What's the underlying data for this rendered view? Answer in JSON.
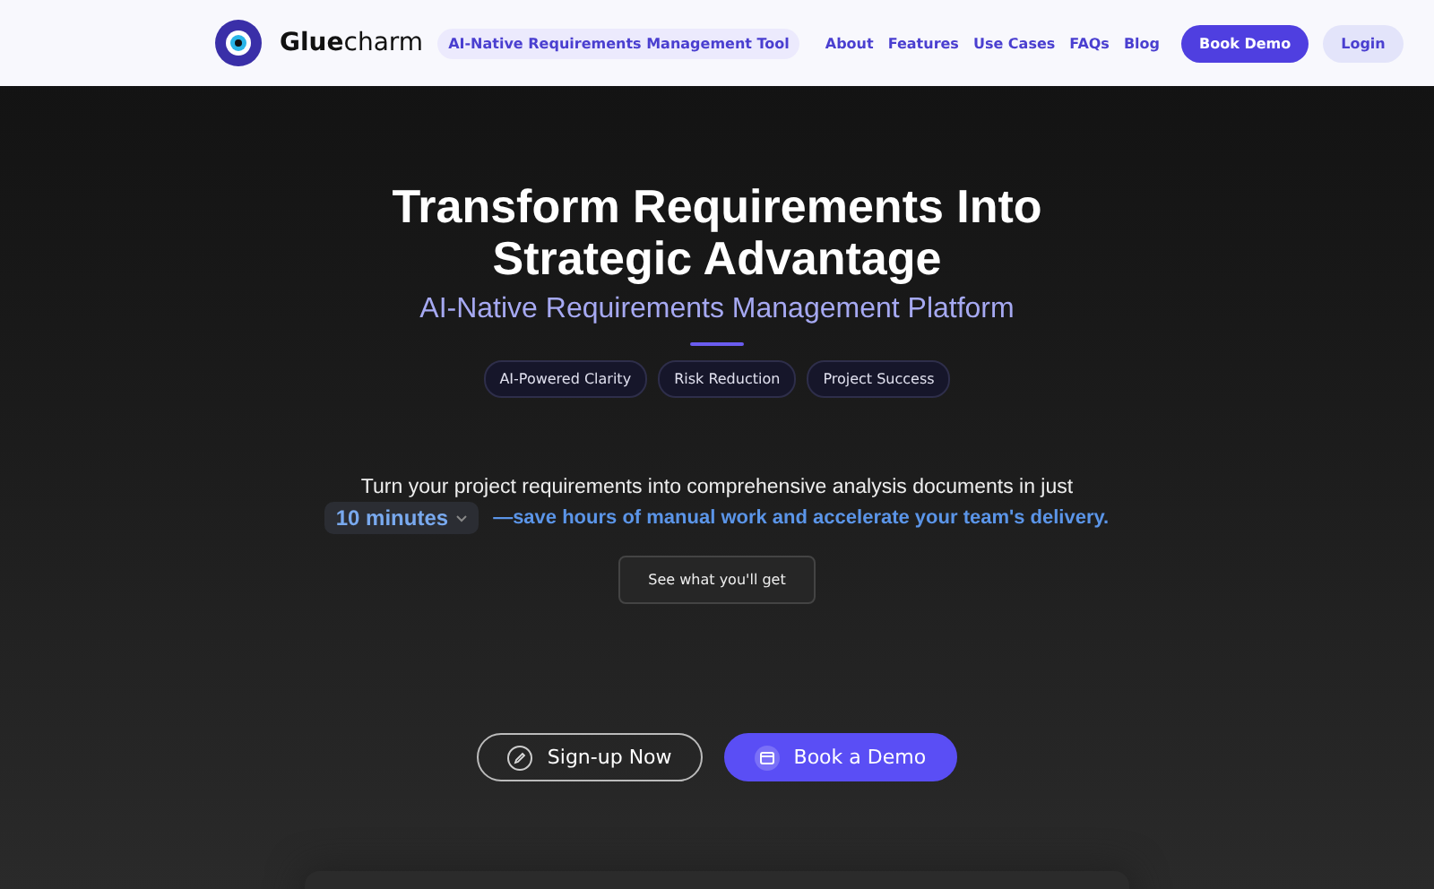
{
  "header": {
    "logo": "**Glue**charm",
    "tagline": "AI-Native Requirements Management Tool",
    "nav": [
      "About",
      "Features",
      "Use Cases",
      "FAQs",
      "Blog"
    ],
    "book_demo": "Book Demo",
    "login": "Login"
  },
  "hero": {
    "title": "Transform Requirements Into Strategic Advantage",
    "subtitle": "AI-Native Requirements Management Platform",
    "tags": [
      "AI-Powered Clarity",
      "Risk Reduction",
      "Project Success"
    ],
    "intro": "Turn your project requirements into comprehensive analysis documents in just",
    "duration": {
      "value": "10 minutes"
    },
    "benefit": "—save hours of manual work and accelerate your team's delivery.",
    "preview_button": "See what you'll get"
  },
  "cta": [
    {
      "kind": "outline",
      "label": "Sign-up Now"
    },
    {
      "kind": "filled",
      "label": "Book a Demo"
    }
  ]
}
